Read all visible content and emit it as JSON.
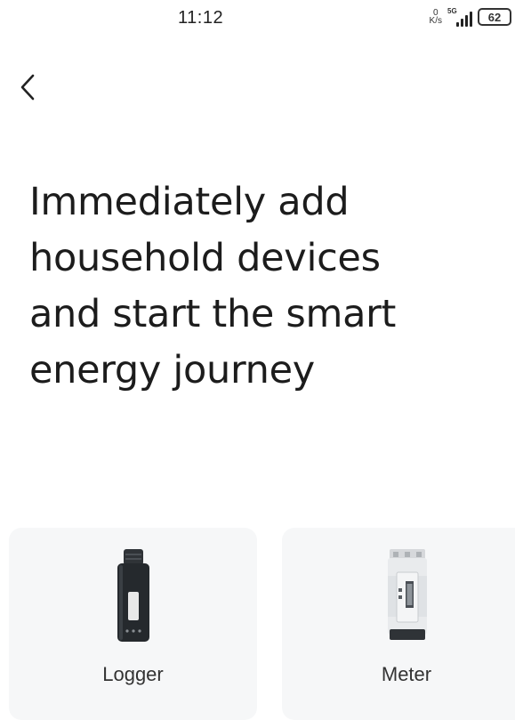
{
  "status_bar": {
    "time": "11:12",
    "net_speed_value": "0",
    "net_speed_unit": "K/s",
    "network_type": "5G",
    "battery": "62"
  },
  "headline": {
    "line1": "Immediately add",
    "line2": "household devices",
    "line3": "and start the smart",
    "line4": "energy journey"
  },
  "devices": [
    {
      "label": "Logger",
      "icon": "logger-device-icon"
    },
    {
      "label": "Meter",
      "icon": "meter-device-icon"
    }
  ],
  "colors": {
    "background": "#ffffff",
    "card": "#f6f7f8",
    "text": "#1c1c1c"
  }
}
